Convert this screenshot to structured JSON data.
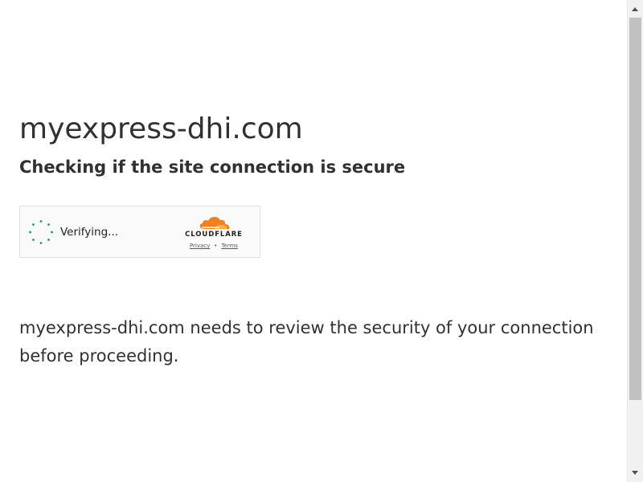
{
  "page": {
    "site_title": "myexpress-dhi.com",
    "subtitle": "Checking if the site connection is secure",
    "message": "myexpress-dhi.com needs to review the security of your connection before proceeding."
  },
  "widget": {
    "status_text": "Verifying...",
    "brand_name": "CLOUDFLARE",
    "privacy_link": "Privacy",
    "separator": "•",
    "terms_link": "Terms",
    "spinner_color": "#1f9d55",
    "brand_color": "#f38020"
  },
  "scrollbar": {
    "icons": [
      "scroll-up-arrow-icon",
      "scroll-down-arrow-icon"
    ]
  }
}
